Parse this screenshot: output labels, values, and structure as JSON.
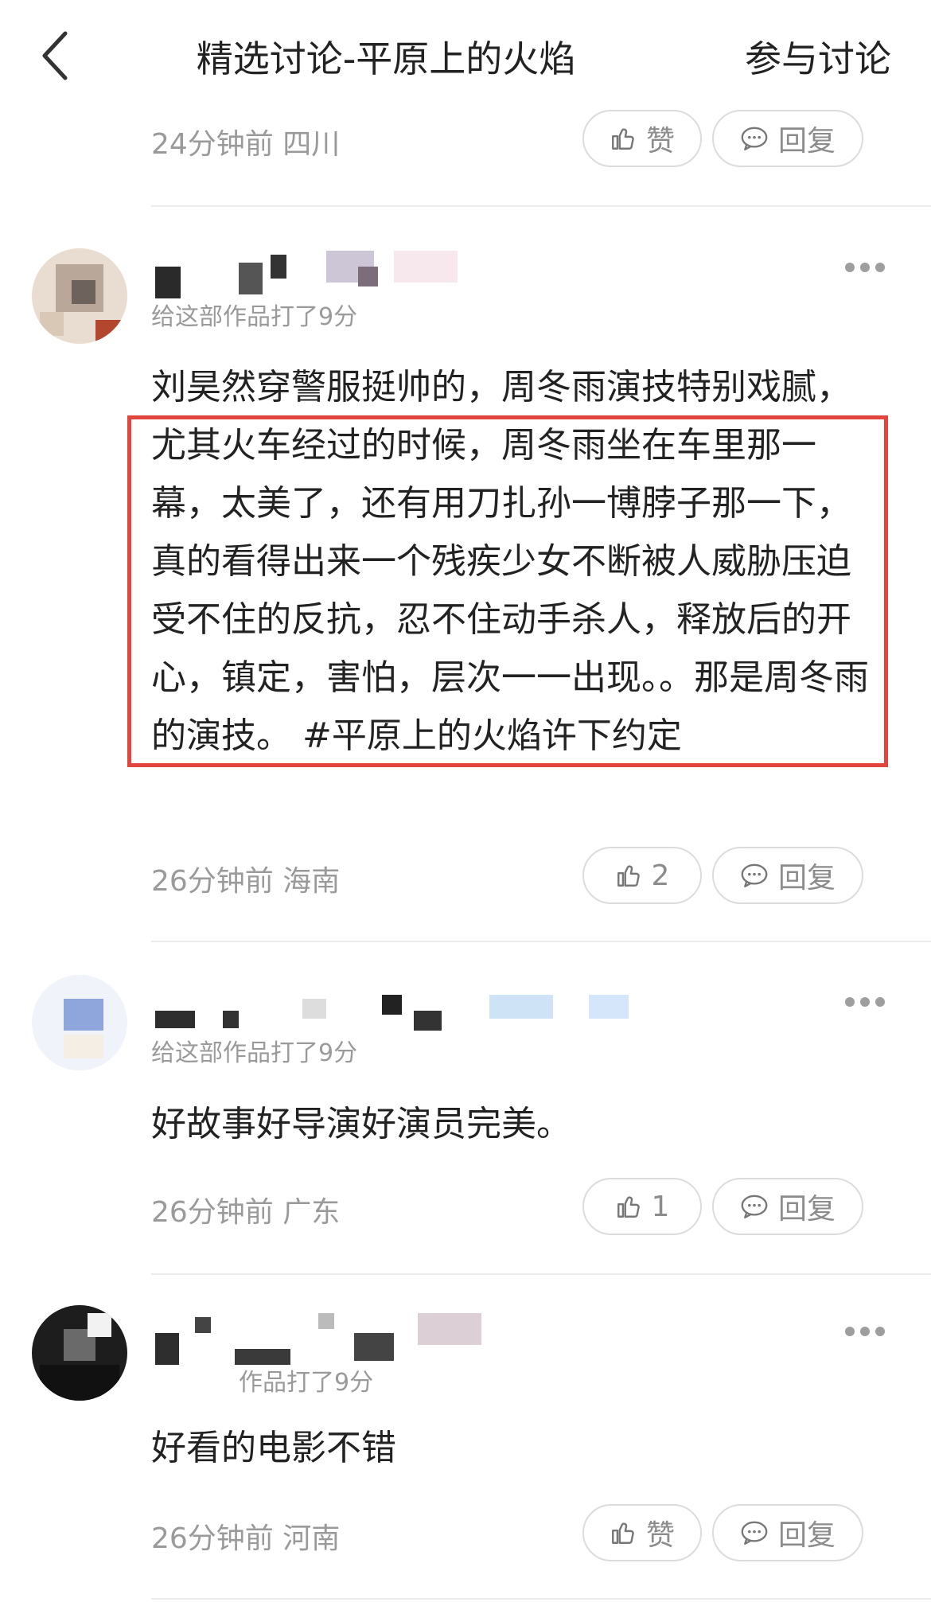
{
  "header": {
    "title": "精选讨论-平原上的火焰",
    "join_label": "参与讨论"
  },
  "icons": {
    "back": "chevron-left-icon",
    "like": "thumbs-up-icon",
    "reply": "chat-bubble-icon",
    "more": "more-dots-icon"
  },
  "top_partial": {
    "meta": "24分钟前 四川",
    "like_label": "赞",
    "reply_label": "回复"
  },
  "comments": [
    {
      "subline": "给这部作品打了9分",
      "text": "刘昊然穿警服挺帅的，周冬雨演技特别戏腻，尤其火车经过的时候，周冬雨坐在车里那一幕，太美了，还有用刀扎孙一博脖子那一下，真的看得出来一个残疾少女不断被人威胁压迫受不住的反抗，忍不住动手杀人，释放后的开心，镇定，害怕，层次一一出现。。那是周冬雨的演技。 #平原上的火焰许下约定",
      "meta": "26分钟前 海南",
      "like_label": "2",
      "reply_label": "回复"
    },
    {
      "subline": "给这部作品打了9分",
      "text": "好故事好导演好演员完美。",
      "meta": "26分钟前 广东",
      "like_label": "1",
      "reply_label": "回复"
    },
    {
      "subline": "作品打了9分",
      "text": "好看的电影不错",
      "meta": "26分钟前 河南",
      "like_label": "赞",
      "reply_label": "回复"
    }
  ],
  "colors": {
    "highlight_border": "#e2453c",
    "meta_gray": "#9a9a9a",
    "divider": "#ececec"
  }
}
